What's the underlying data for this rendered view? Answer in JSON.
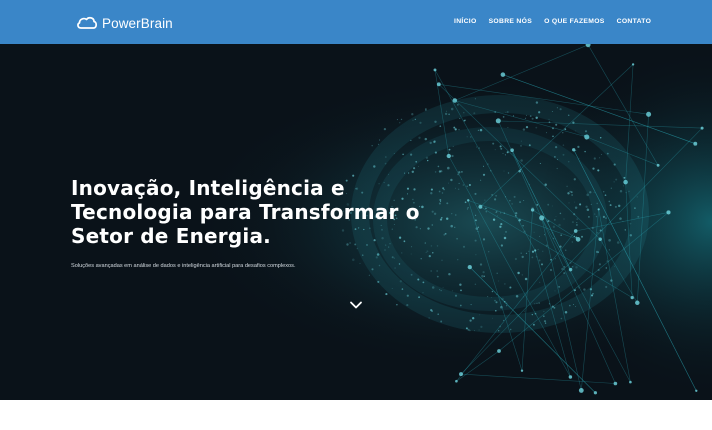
{
  "brand": {
    "name": "PowerBrain",
    "icon": "cloud-logo-icon"
  },
  "nav": {
    "items": [
      {
        "label": "INÍCIO"
      },
      {
        "label": "SOBRE NÓS"
      },
      {
        "label": "O QUE FAZEMOS"
      },
      {
        "label": "CONTATO"
      }
    ]
  },
  "hero": {
    "title": "Inovação, Inteligência e Tecnologia para Transformar o Setor de Energia.",
    "subtitle": "Soluções avançadas em análise de dados e inteligência artificial para desafios complexos.",
    "scroll_icon": "chevron-down-icon"
  },
  "colors": {
    "navbar": "#3a86c8",
    "hero_bg": "#0a1219",
    "accent_teal": "#2fb5c4",
    "text": "#ffffff"
  }
}
